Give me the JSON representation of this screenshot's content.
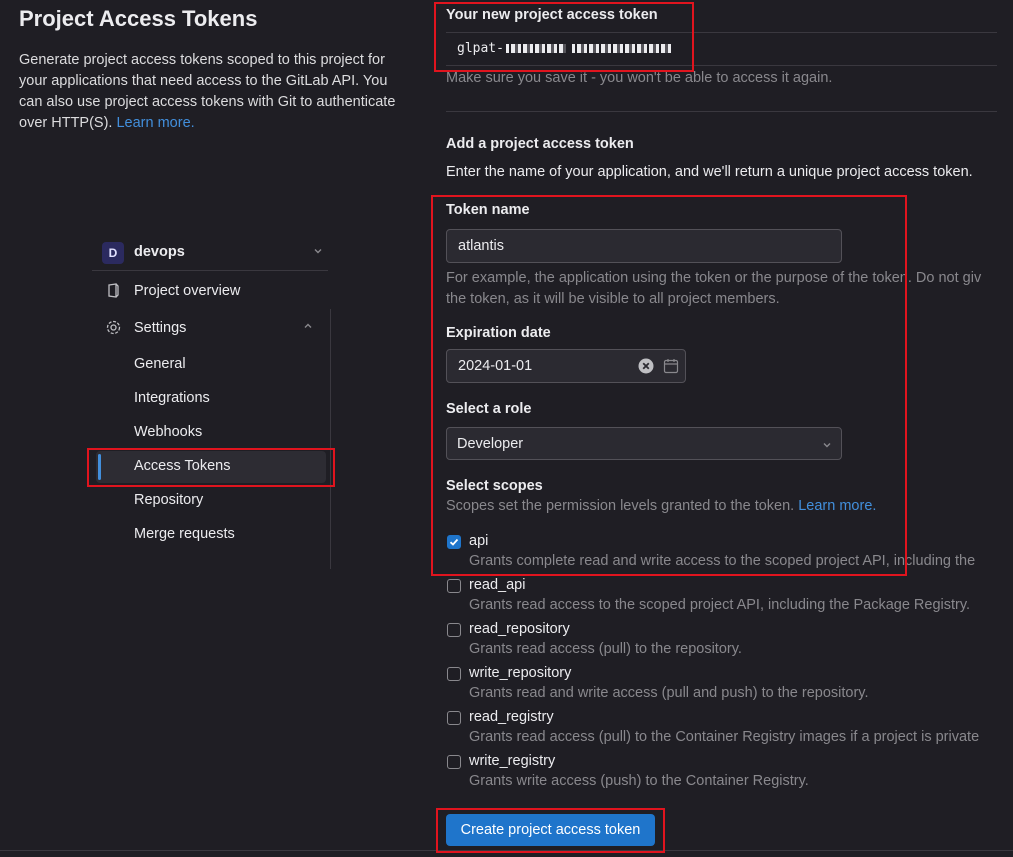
{
  "page": {
    "title": "Project Access Tokens",
    "description": "Generate project access tokens scoped to this project for your applications that need access to the GitLab API. You can also use project access tokens with Git to authenticate over HTTP(S).",
    "learn_more": "Learn more."
  },
  "sidebar": {
    "project_initial": "D",
    "project_name": "devops",
    "project_overview": "Project overview",
    "settings": "Settings",
    "items": [
      "General",
      "Integrations",
      "Webhooks",
      "Access Tokens",
      "Repository",
      "Merge requests"
    ],
    "active_item": "Access Tokens"
  },
  "new_token": {
    "heading": "Your new project access token",
    "value_prefix": "glpat-",
    "hint": "Make sure you save it - you won't be able to access it again."
  },
  "form": {
    "heading": "Add a project access token",
    "intro": "Enter the name of your application, and we'll return a unique project access token.",
    "token_name_label": "Token name",
    "token_name_value": "atlantis",
    "token_name_help": "For example, the application using the token or the purpose of the token. Do not give sensitive information for the name of the token, as it will be visible to all project members.",
    "token_name_help_line1": "For example, the application using the token or the purpose of the token. Do not giv",
    "token_name_help_line2": "the token, as it will be visible to all project members.",
    "expiration_label": "Expiration date",
    "expiration_value": "2024-01-01",
    "role_label": "Select a role",
    "role_value": "Developer",
    "scopes_label": "Select scopes",
    "scopes_help": "Scopes set the permission levels granted to the token.",
    "scopes_learn_more": "Learn more.",
    "scopes": [
      {
        "name": "api",
        "checked": true,
        "desc": "Grants complete read and write access to the scoped project API, including the"
      },
      {
        "name": "read_api",
        "checked": false,
        "desc": "Grants read access to the scoped project API, including the Package Registry."
      },
      {
        "name": "read_repository",
        "checked": false,
        "desc": "Grants read access (pull) to the repository."
      },
      {
        "name": "write_repository",
        "checked": false,
        "desc": "Grants read and write access (pull and push) to the repository."
      },
      {
        "name": "read_registry",
        "checked": false,
        "desc": "Grants read access (pull) to the Container Registry images if a project is private"
      },
      {
        "name": "write_registry",
        "checked": false,
        "desc": "Grants write access (push) to the Container Registry."
      }
    ],
    "submit": "Create project access token"
  },
  "colors": {
    "accent": "#1f75cb",
    "link": "#428fdc",
    "highlight": "#e0141e"
  }
}
